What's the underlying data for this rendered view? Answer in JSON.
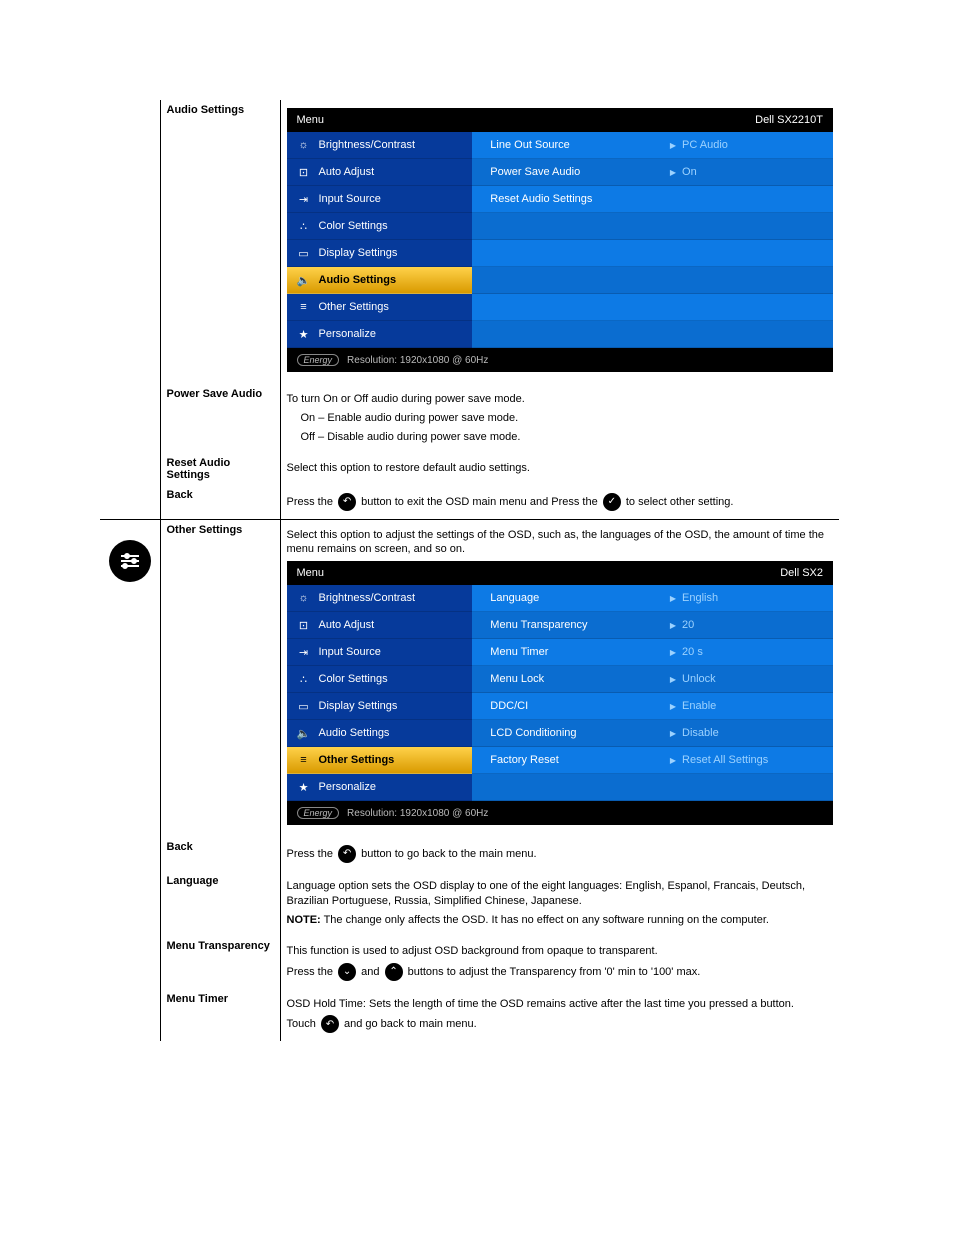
{
  "monitor_model": "Dell SX2210T",
  "monitor_model_trunc": "Dell SX2",
  "osd_menu_title": "Menu",
  "osd_left_items": [
    {
      "label": "Brightness/Contrast",
      "icon": "☼"
    },
    {
      "label": "Auto Adjust",
      "icon": "⊡"
    },
    {
      "label": "Input Source",
      "icon": "⇥"
    },
    {
      "label": "Color Settings",
      "icon": "∴"
    },
    {
      "label": "Display Settings",
      "icon": "▭"
    },
    {
      "label": "Audio Settings",
      "icon": "🔈"
    },
    {
      "label": "Other Settings",
      "icon": "≡"
    },
    {
      "label": "Personalize",
      "icon": "★"
    }
  ],
  "osd_footer": {
    "energy": "Energy",
    "res": "Resolution: 1920x1080 @ 60Hz"
  },
  "audio_menu": {
    "selected_index": 5,
    "options": [
      {
        "label": "Line Out Source",
        "value": "PC Audio"
      },
      {
        "label": "Power Save Audio",
        "value": "On"
      },
      {
        "label": "Reset Audio Settings",
        "value": ""
      }
    ]
  },
  "other_menu": {
    "selected_index": 6,
    "options": [
      {
        "label": "Language",
        "value": "English"
      },
      {
        "label": "Menu Transparency",
        "value": "20"
      },
      {
        "label": "Menu Timer",
        "value": "20 s"
      },
      {
        "label": "Menu Lock",
        "value": "Unlock"
      },
      {
        "label": "DDC/CI",
        "value": "Enable"
      },
      {
        "label": "LCD Conditioning",
        "value": "Disable"
      },
      {
        "label": "Factory Reset",
        "value": "Reset All Settings"
      }
    ]
  },
  "rows": {
    "audio_settings_label": "Audio Settings",
    "power_save_audio_label": "Power Save Audio",
    "power_save_audio_desc": "To turn On or Off audio during power save mode.",
    "power_save_on": "On – Enable audio during power save mode.",
    "power_save_off": "Off – Disable audio during power save mode.",
    "reset_audio_label": "Reset Audio Settings",
    "reset_audio_desc": "Select this option to restore default audio settings.",
    "back_label": "Back",
    "back_audio_text1": "Press the ",
    "back_audio_text2": " button  to exit the OSD main menu and Press the ",
    "back_audio_text3": " to select other setting.",
    "other_settings_label": "Other Settings",
    "other_settings_desc": "Select this option to adjust the settings of the OSD, such as, the languages of the OSD, the amount of time the menu remains on screen, and so on.",
    "back_other_label": "Back",
    "back_other_text1": "Press the ",
    "back_other_text2": " button to go back to the main menu.",
    "language_label": "Language",
    "language_desc_1": "Language option sets the OSD display to one of the eight languages: English, Espanol, Francais, Deutsch, Brazilian Portuguese, Russia, Simplified Chinese, Japanese.",
    "language_note_label": "NOTE:",
    "language_note": " The change only affects the OSD. It has no effect on any software running on the computer.",
    "menu_transparency_label": "Menu Transparency",
    "menu_transparency_desc_1": "This function is used to adjust OSD background from opaque to transparent.",
    "menu_transparency_desc_2a": "Press the ",
    "menu_transparency_desc_2b": " and ",
    "menu_transparency_desc_2c": " buttons to adjust the Transparency from '0' min to '100' max.",
    "menu_timer_label": "Menu Timer",
    "menu_timer_desc_1": "OSD Hold Time: Sets the length of time the OSD remains active after the last time you pressed a button.",
    "menu_timer_desc_2a": "Touch ",
    "menu_timer_desc_2b": " and go back to main menu."
  }
}
